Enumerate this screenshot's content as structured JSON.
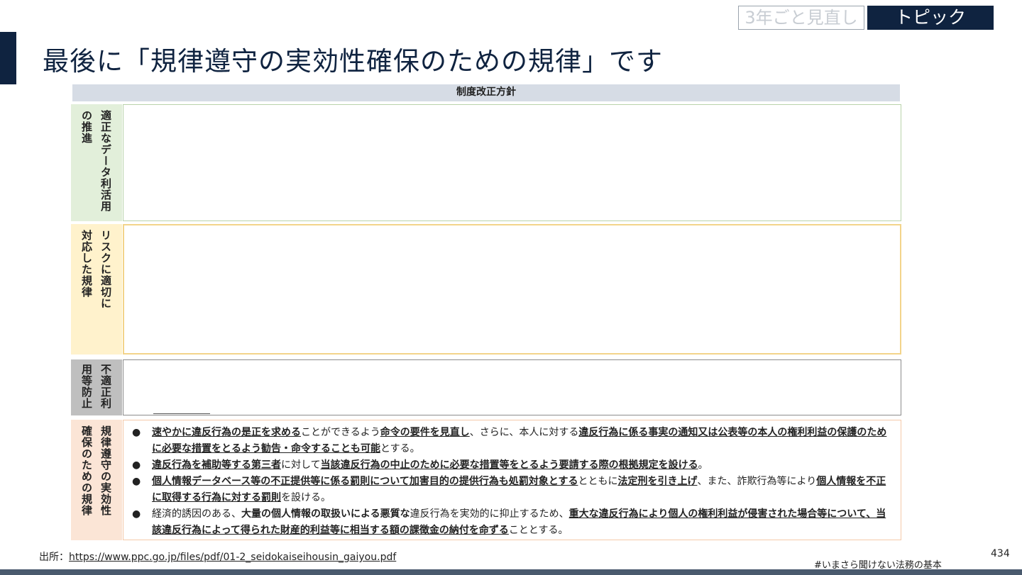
{
  "header": {
    "title": "最後に「規律遵守の実効性確保のための規律」です",
    "tag_faded": "3年ごと見直し",
    "tag_topic": "トピック"
  },
  "table": {
    "header": "制度改正方針",
    "rows": [
      {
        "label_cols": [
          "適正なデータ利活用",
          "の推進"
        ]
      },
      {
        "label_cols": [
          "リスクに適切に",
          "対応した規律"
        ]
      },
      {
        "label_cols": [
          "不適正利",
          "用等防止"
        ]
      },
      {
        "label_cols": [
          "規律遵守の実効性",
          "確保のための規律"
        ],
        "bullets": [
          {
            "segments": [
              {
                "t": "速やかに違反行為の是正を求める",
                "b": true
              },
              {
                "t": "ことができるよう",
                "b": false
              },
              {
                "t": "命令の要件を見直し",
                "b": true
              },
              {
                "t": "、さらに、本人に対する",
                "b": false
              },
              {
                "t": "違反行為に係る事実の通知又は公表等の本人の権利利益の保護のために必要な措置をとるよう勧告・命令することも可能",
                "b": true
              },
              {
                "t": "とする。",
                "b": false
              }
            ]
          },
          {
            "segments": [
              {
                "t": "違反行為を補助等する第三者",
                "b": true
              },
              {
                "t": "に対して",
                "b": false
              },
              {
                "t": "当該違反行為の中止のために必要な措置等をとるよう要請する際の根拠規定を設ける",
                "b": true
              },
              {
                "t": "。",
                "b": false
              }
            ]
          },
          {
            "segments": [
              {
                "t": "個人情報データベース等の不正提供等に係る罰則について加害目的の提供行為も処罰対象とする",
                "b": true
              },
              {
                "t": "とともに",
                "b": false
              },
              {
                "t": "法定刑を引き上げ",
                "b": true
              },
              {
                "t": "、また、詐欺行為等により",
                "b": false
              },
              {
                "t": "個人情報を不正に取得する行為に対する罰則",
                "b": true
              },
              {
                "t": "を設ける。",
                "b": false
              }
            ]
          },
          {
            "segments": [
              {
                "t": "経済的誘因のある、",
                "b": false
              },
              {
                "t": "大量の個人情報の取扱いによる悪質な",
                "b": "plain"
              },
              {
                "t": "違反行為を実効的に抑止するため、",
                "b": false
              },
              {
                "t": "重大な違反行為により個人の権利利益が侵害された場合等について、当該違反行為によって得られた財産的利益等に相当する額の課徴金の納付を命ずる",
                "b": true
              },
              {
                "t": "こととする。",
                "b": false
              }
            ]
          }
        ]
      }
    ]
  },
  "footer": {
    "source_prefix": "出所：",
    "source_url": "https://www.ppc.go.jp/files/pdf/01-2_seidokaiseihousin_gaiyou.pdf",
    "hashtag": "#いまさら聞けない法務の基本",
    "page_number": "434"
  },
  "colors": {
    "navy": "#0f2340",
    "row1": "#e2efda",
    "row2": "#fff2cc",
    "row3": "#bfbfbf",
    "row4": "#fbe5d6"
  }
}
